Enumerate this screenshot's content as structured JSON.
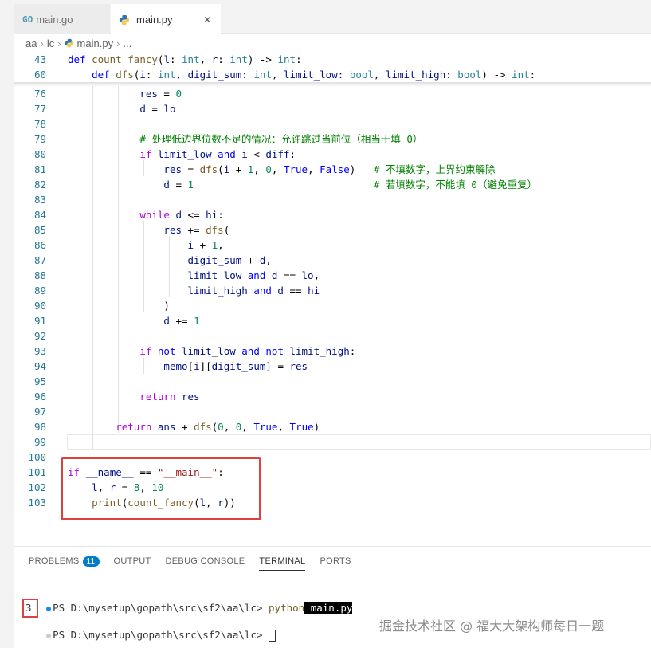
{
  "tabs": [
    {
      "label": "main.go",
      "icon": "go-file-icon"
    },
    {
      "label": "main.py",
      "icon": "python-file-icon"
    }
  ],
  "breadcrumb": [
    "aa",
    "lc",
    "main.py",
    "..."
  ],
  "sticky": [
    {
      "num": "43",
      "code": "def count_fancy(l: int, r: int) -> int:"
    },
    {
      "num": "60",
      "code": "    def dfs(i: int, digit_sum: int, limit_low: bool, limit_high: bool) -> int:"
    }
  ],
  "lines": [
    {
      "num": "76",
      "code": "            res = 0"
    },
    {
      "num": "77",
      "code": "            d = lo"
    },
    {
      "num": "78",
      "code": ""
    },
    {
      "num": "79",
      "code": "            # 处理低边界位数不足的情况：允许跳过当前位（相当于填 0）"
    },
    {
      "num": "80",
      "code": "            if limit_low and i < diff:"
    },
    {
      "num": "81",
      "code": "                res = dfs(i + 1, 0, True, False)   # 不填数字，上界约束解除"
    },
    {
      "num": "82",
      "code": "                d = 1                              # 若填数字，不能填 0（避免重复）"
    },
    {
      "num": "83",
      "code": ""
    },
    {
      "num": "84",
      "code": "            while d <= hi:"
    },
    {
      "num": "85",
      "code": "                res += dfs("
    },
    {
      "num": "86",
      "code": "                    i + 1,"
    },
    {
      "num": "87",
      "code": "                    digit_sum + d,"
    },
    {
      "num": "88",
      "code": "                    limit_low and d == lo,"
    },
    {
      "num": "89",
      "code": "                    limit_high and d == hi"
    },
    {
      "num": "90",
      "code": "                )"
    },
    {
      "num": "91",
      "code": "                d += 1"
    },
    {
      "num": "92",
      "code": ""
    },
    {
      "num": "93",
      "code": "            if not limit_low and not limit_high:"
    },
    {
      "num": "94",
      "code": "                memo[i][digit_sum] = res"
    },
    {
      "num": "95",
      "code": ""
    },
    {
      "num": "96",
      "code": "            return res"
    },
    {
      "num": "97",
      "code": ""
    },
    {
      "num": "98",
      "code": "        return ans + dfs(0, 0, True, True)"
    },
    {
      "num": "99",
      "code": ""
    },
    {
      "num": "100",
      "code": ""
    },
    {
      "num": "101",
      "code": "if __name__ == \"__main__\":"
    },
    {
      "num": "102",
      "code": "    l, r = 8, 10"
    },
    {
      "num": "103",
      "code": "    print(count_fancy(l, r))"
    }
  ],
  "panel": {
    "tabs": [
      "PROBLEMS",
      "OUTPUT",
      "DEBUG CONSOLE",
      "TERMINAL",
      "PORTS"
    ],
    "problems_count": "11",
    "active_tab": "TERMINAL"
  },
  "terminal": {
    "prompt1": "PS D:\\mysetup\\gopath\\src\\sf2\\aa\\lc> ",
    "cmd": "python",
    "arg": " main.py",
    "output": "3",
    "prompt2": "PS D:\\mysetup\\gopath\\src\\sf2\\aa\\lc> "
  },
  "watermark": "掘金技术社区 @ 福大大架构师每日一题",
  "colors": {
    "accent": "#007acc",
    "highlight": "#e04040"
  }
}
